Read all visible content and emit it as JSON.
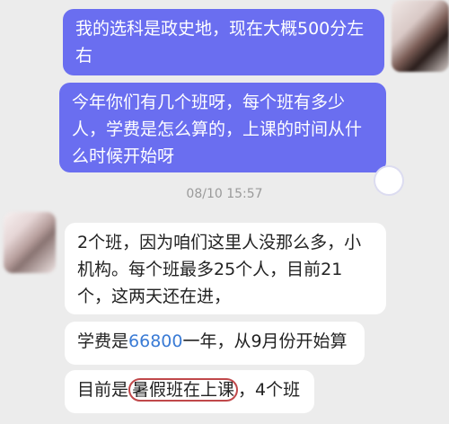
{
  "messages": [
    {
      "sender": "self",
      "text": "我的选科是政史地，现在大概500分左右"
    },
    {
      "sender": "self",
      "text": "今年你们有几个班呀，每个班有多少人，学费是怎么算的，上课的时间从什么时候开始呀"
    },
    {
      "sender": "other",
      "text": "2个班，因为咱们这里人没那么多，小机构。每个班最多25个人，目前21个，这两天还在进，"
    },
    {
      "sender": "other",
      "pre": "学费是",
      "amount": "66800",
      "post": "一年，从9月份开始算"
    },
    {
      "sender": "other",
      "pre": "目前是",
      "highlight": "暑假班在上课",
      "post": "，4个班"
    }
  ],
  "timestamp": "08/10 15:57",
  "colors": {
    "outgoing_bubble": "#6a6ef0",
    "incoming_bubble": "#ffffff",
    "background": "#ececec",
    "amount_link": "#3a7bd5",
    "annotation_circle": "#c0484a"
  }
}
